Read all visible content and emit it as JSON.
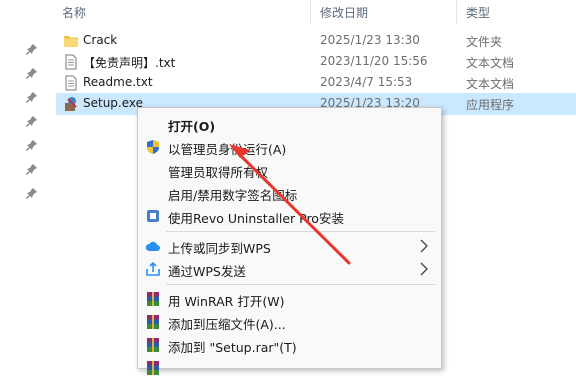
{
  "header": {
    "col_name": "名称",
    "col_date": "修改日期",
    "col_type": "类型"
  },
  "files": [
    {
      "name": "Crack",
      "date": "2025/1/23 13:30",
      "type": "文件夹",
      "icon": "folder-icon",
      "selected": false
    },
    {
      "name": "【免责声明】.txt",
      "date": "2023/11/20 15:56",
      "type": "文本文档",
      "icon": "text-file-icon",
      "selected": false
    },
    {
      "name": "Readme.txt",
      "date": "2023/4/7 15:53",
      "type": "文本文档",
      "icon": "text-file-icon",
      "selected": false
    },
    {
      "name": "Setup.exe",
      "date": "2025/1/23 13:20",
      "type": "应用程序",
      "icon": "installer-icon",
      "selected": true
    }
  ],
  "context_menu": {
    "items": [
      {
        "label": "打开(O)",
        "bold": true,
        "icon": ""
      },
      {
        "label": "以管理员身份运行(A)",
        "icon": "uac-shield-icon"
      },
      {
        "label": "管理员取得所有权",
        "icon": ""
      },
      {
        "label": "启用/禁用数字签名图标",
        "icon": ""
      },
      {
        "label": "使用Revo Uninstaller Pro安装",
        "icon": "revo-uninstaller-icon"
      },
      {
        "label": "上传或同步到WPS",
        "icon": "wps-cloud-icon",
        "submenu": true
      },
      {
        "label": "通过WPS发送",
        "icon": "wps-share-icon",
        "submenu": true
      },
      {
        "label": "用 WinRAR 打开(W)",
        "icon": "winrar-icon"
      },
      {
        "label": "添加到压缩文件(A)...",
        "icon": "winrar-icon"
      },
      {
        "label": "添加到 \"Setup.rar\"(T)",
        "icon": "winrar-icon"
      }
    ]
  },
  "colors": {
    "selection": "#cce8ff",
    "annotation_arrow": "#e8372c",
    "folder": "#f0c14b"
  }
}
